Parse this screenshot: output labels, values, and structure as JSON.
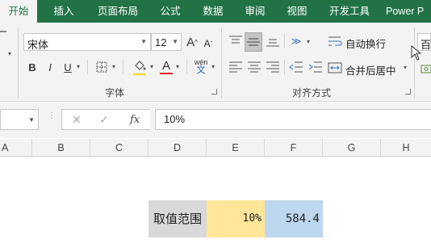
{
  "ribbon_tabs": [
    "开始",
    "插入",
    "页面布局",
    "公式",
    "数据",
    "审阅",
    "视图",
    "开发工具",
    "Power P"
  ],
  "font_group": {
    "font_name": "宋体",
    "font_size": "12",
    "grow_font": "A",
    "shrink_font": "A",
    "bold": "B",
    "italic": "I",
    "underline": "U",
    "font_color": "A",
    "phonetic": "wén",
    "label": "字体"
  },
  "alignment_group": {
    "wrap_text": "自动换行",
    "merge_center": "合并后居中",
    "label": "对齐方式"
  },
  "number_group": {
    "format_partial": "百"
  },
  "formula_bar": {
    "cancel": "✕",
    "enter": "✓",
    "fx": "fx",
    "content": "10%"
  },
  "columns": [
    "A",
    "B",
    "C",
    "D",
    "E",
    "F",
    "G",
    "H"
  ],
  "cells": [
    {
      "ref": "D",
      "value": "取值范围"
    },
    {
      "ref": "E",
      "value": "10%"
    },
    {
      "ref": "F",
      "value": "584.4"
    }
  ],
  "colors": {
    "ribbon_green": "#217346",
    "cell_d_fill": "#d9d9d9",
    "cell_e_fill": "#ffe699",
    "cell_f_fill": "#bdd7ee",
    "highlight_yellow": "#ffd700",
    "font_red": "#e02020"
  }
}
